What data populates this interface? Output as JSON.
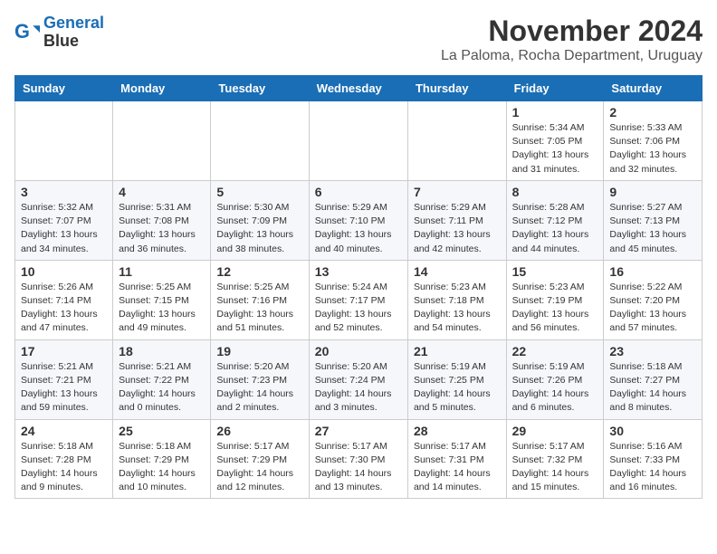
{
  "logo": {
    "line1": "General",
    "line2": "Blue"
  },
  "title": "November 2024",
  "location": "La Paloma, Rocha Department, Uruguay",
  "weekdays": [
    "Sunday",
    "Monday",
    "Tuesday",
    "Wednesday",
    "Thursday",
    "Friday",
    "Saturday"
  ],
  "weeks": [
    [
      {
        "day": "",
        "info": ""
      },
      {
        "day": "",
        "info": ""
      },
      {
        "day": "",
        "info": ""
      },
      {
        "day": "",
        "info": ""
      },
      {
        "day": "",
        "info": ""
      },
      {
        "day": "1",
        "info": "Sunrise: 5:34 AM\nSunset: 7:05 PM\nDaylight: 13 hours\nand 31 minutes."
      },
      {
        "day": "2",
        "info": "Sunrise: 5:33 AM\nSunset: 7:06 PM\nDaylight: 13 hours\nand 32 minutes."
      }
    ],
    [
      {
        "day": "3",
        "info": "Sunrise: 5:32 AM\nSunset: 7:07 PM\nDaylight: 13 hours\nand 34 minutes."
      },
      {
        "day": "4",
        "info": "Sunrise: 5:31 AM\nSunset: 7:08 PM\nDaylight: 13 hours\nand 36 minutes."
      },
      {
        "day": "5",
        "info": "Sunrise: 5:30 AM\nSunset: 7:09 PM\nDaylight: 13 hours\nand 38 minutes."
      },
      {
        "day": "6",
        "info": "Sunrise: 5:29 AM\nSunset: 7:10 PM\nDaylight: 13 hours\nand 40 minutes."
      },
      {
        "day": "7",
        "info": "Sunrise: 5:29 AM\nSunset: 7:11 PM\nDaylight: 13 hours\nand 42 minutes."
      },
      {
        "day": "8",
        "info": "Sunrise: 5:28 AM\nSunset: 7:12 PM\nDaylight: 13 hours\nand 44 minutes."
      },
      {
        "day": "9",
        "info": "Sunrise: 5:27 AM\nSunset: 7:13 PM\nDaylight: 13 hours\nand 45 minutes."
      }
    ],
    [
      {
        "day": "10",
        "info": "Sunrise: 5:26 AM\nSunset: 7:14 PM\nDaylight: 13 hours\nand 47 minutes."
      },
      {
        "day": "11",
        "info": "Sunrise: 5:25 AM\nSunset: 7:15 PM\nDaylight: 13 hours\nand 49 minutes."
      },
      {
        "day": "12",
        "info": "Sunrise: 5:25 AM\nSunset: 7:16 PM\nDaylight: 13 hours\nand 51 minutes."
      },
      {
        "day": "13",
        "info": "Sunrise: 5:24 AM\nSunset: 7:17 PM\nDaylight: 13 hours\nand 52 minutes."
      },
      {
        "day": "14",
        "info": "Sunrise: 5:23 AM\nSunset: 7:18 PM\nDaylight: 13 hours\nand 54 minutes."
      },
      {
        "day": "15",
        "info": "Sunrise: 5:23 AM\nSunset: 7:19 PM\nDaylight: 13 hours\nand 56 minutes."
      },
      {
        "day": "16",
        "info": "Sunrise: 5:22 AM\nSunset: 7:20 PM\nDaylight: 13 hours\nand 57 minutes."
      }
    ],
    [
      {
        "day": "17",
        "info": "Sunrise: 5:21 AM\nSunset: 7:21 PM\nDaylight: 13 hours\nand 59 minutes."
      },
      {
        "day": "18",
        "info": "Sunrise: 5:21 AM\nSunset: 7:22 PM\nDaylight: 14 hours\nand 0 minutes."
      },
      {
        "day": "19",
        "info": "Sunrise: 5:20 AM\nSunset: 7:23 PM\nDaylight: 14 hours\nand 2 minutes."
      },
      {
        "day": "20",
        "info": "Sunrise: 5:20 AM\nSunset: 7:24 PM\nDaylight: 14 hours\nand 3 minutes."
      },
      {
        "day": "21",
        "info": "Sunrise: 5:19 AM\nSunset: 7:25 PM\nDaylight: 14 hours\nand 5 minutes."
      },
      {
        "day": "22",
        "info": "Sunrise: 5:19 AM\nSunset: 7:26 PM\nDaylight: 14 hours\nand 6 minutes."
      },
      {
        "day": "23",
        "info": "Sunrise: 5:18 AM\nSunset: 7:27 PM\nDaylight: 14 hours\nand 8 minutes."
      }
    ],
    [
      {
        "day": "24",
        "info": "Sunrise: 5:18 AM\nSunset: 7:28 PM\nDaylight: 14 hours\nand 9 minutes."
      },
      {
        "day": "25",
        "info": "Sunrise: 5:18 AM\nSunset: 7:29 PM\nDaylight: 14 hours\nand 10 minutes."
      },
      {
        "day": "26",
        "info": "Sunrise: 5:17 AM\nSunset: 7:29 PM\nDaylight: 14 hours\nand 12 minutes."
      },
      {
        "day": "27",
        "info": "Sunrise: 5:17 AM\nSunset: 7:30 PM\nDaylight: 14 hours\nand 13 minutes."
      },
      {
        "day": "28",
        "info": "Sunrise: 5:17 AM\nSunset: 7:31 PM\nDaylight: 14 hours\nand 14 minutes."
      },
      {
        "day": "29",
        "info": "Sunrise: 5:17 AM\nSunset: 7:32 PM\nDaylight: 14 hours\nand 15 minutes."
      },
      {
        "day": "30",
        "info": "Sunrise: 5:16 AM\nSunset: 7:33 PM\nDaylight: 14 hours\nand 16 minutes."
      }
    ]
  ]
}
